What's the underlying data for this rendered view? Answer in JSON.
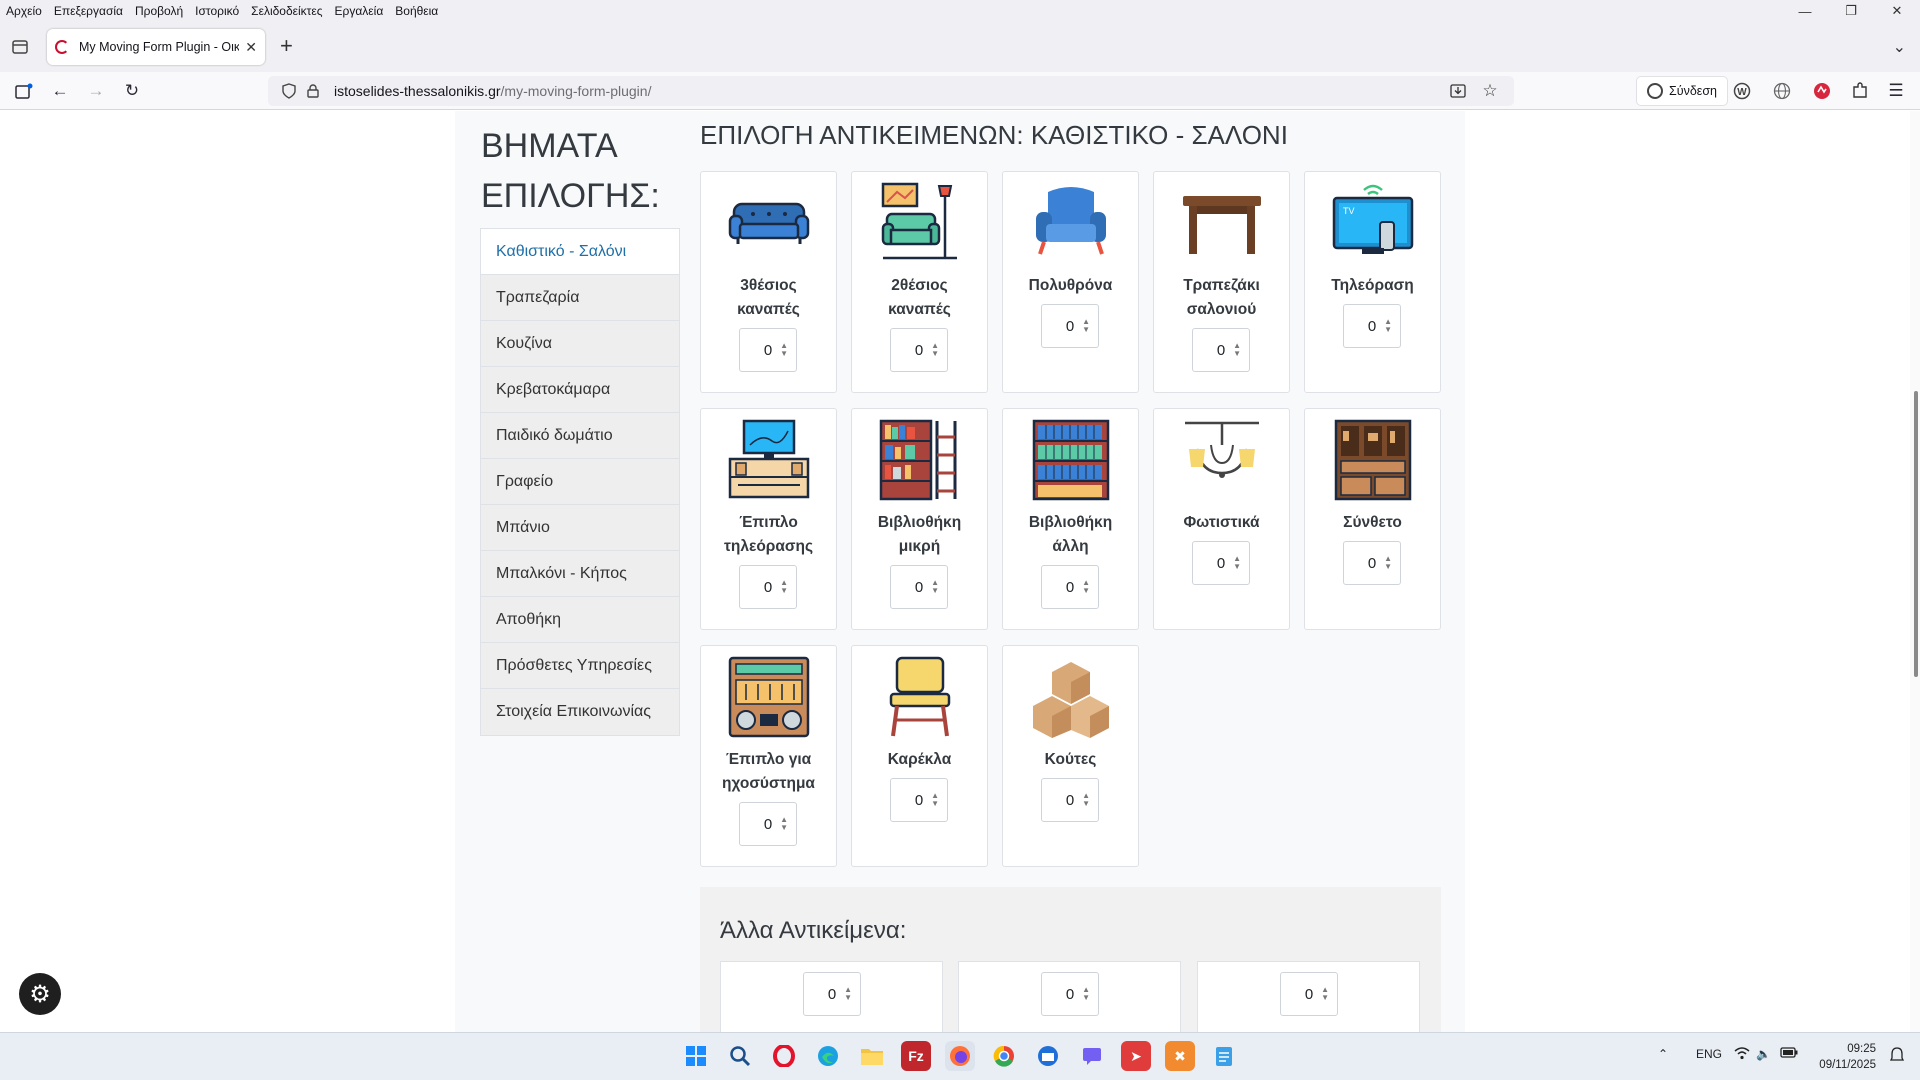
{
  "browser": {
    "menu": [
      "Αρχείο",
      "Επεξεργασία",
      "Προβολή",
      "Ιστορικό",
      "Σελιδοδείκτες",
      "Εργαλεία",
      "Βοήθεια"
    ],
    "tab_title": "My Moving Form Plugin - Οικια",
    "url_host": "istoselides-thessalonikis.gr",
    "url_path": "/my-moving-form-plugin/",
    "signin_label": "Σύνδεση"
  },
  "sidebar": {
    "title": "ΒΗΜΑΤΑ ΕΠΙΛΟΓΗΣ:",
    "steps": [
      {
        "label": "Καθιστικό - Σαλόνι",
        "active": true
      },
      {
        "label": "Τραπεζαρία"
      },
      {
        "label": "Κουζίνα"
      },
      {
        "label": "Κρεβατοκάμαρα"
      },
      {
        "label": "Παιδικό δωμάτιο"
      },
      {
        "label": "Γραφείο"
      },
      {
        "label": "Μπάνιο"
      },
      {
        "label": "Μπαλκόνι - Κήπος"
      },
      {
        "label": "Αποθήκη"
      },
      {
        "label": "Πρόσθετες Υπηρεσίες"
      },
      {
        "label": "Στοιχεία Επικοινωνίας"
      }
    ]
  },
  "main": {
    "title": "ΕΠΙΛΟΓΗ ΑΝΤΙΚΕΙΜΕΝΩΝ: ΚΑΘΙΣΤΙΚΟ - ΣΑΛΟΝΙ",
    "items": [
      {
        "line1": "3θέσιος",
        "line2": "καναπές",
        "qty": "0",
        "icon": "three-seat-sofa-icon"
      },
      {
        "line1": "2θέσιος",
        "line2": "καναπές",
        "qty": "0",
        "icon": "two-seat-sofa-icon"
      },
      {
        "line1": "Πολυθρόνα",
        "line2": "",
        "qty": "0",
        "icon": "armchair-icon"
      },
      {
        "line1": "Τραπεζάκι",
        "line2": "σαλονιού",
        "qty": "0",
        "icon": "coffee-table-icon"
      },
      {
        "line1": "Τηλεόραση",
        "line2": "",
        "qty": "0",
        "icon": "tv-icon"
      },
      {
        "line1": "Έπιπλο",
        "line2": "τηλεόρασης",
        "qty": "0",
        "icon": "tv-unit-icon"
      },
      {
        "line1": "Βιβλιοθήκη",
        "line2": "μικρή",
        "qty": "0",
        "icon": "small-bookcase-icon"
      },
      {
        "line1": "Βιβλιοθήκη",
        "line2": "άλλη",
        "qty": "0",
        "icon": "bookcase-icon"
      },
      {
        "line1": "Φωτιστικά",
        "line2": "",
        "qty": "0",
        "icon": "chandelier-icon"
      },
      {
        "line1": "Σύνθετο",
        "line2": "",
        "qty": "0",
        "icon": "wall-unit-icon"
      },
      {
        "line1": "Έπιπλο για",
        "line2": "ηχοσύστημα",
        "qty": "0",
        "icon": "stereo-unit-icon"
      },
      {
        "line1": "Καρέκλα",
        "line2": "",
        "qty": "0",
        "icon": "chair-icon"
      },
      {
        "line1": "Κούτες",
        "line2": "",
        "qty": "0",
        "icon": "boxes-icon"
      }
    ]
  },
  "other": {
    "title": "Άλλα Αντικείμενα:",
    "qtys": [
      "0",
      "0",
      "0"
    ]
  },
  "taskbar": {
    "lang": "ENG",
    "time": "09:25",
    "date": "09/11/2025"
  },
  "colors": {
    "active_step": "#1f6fa8",
    "container_bg": "#f8f9fa"
  }
}
